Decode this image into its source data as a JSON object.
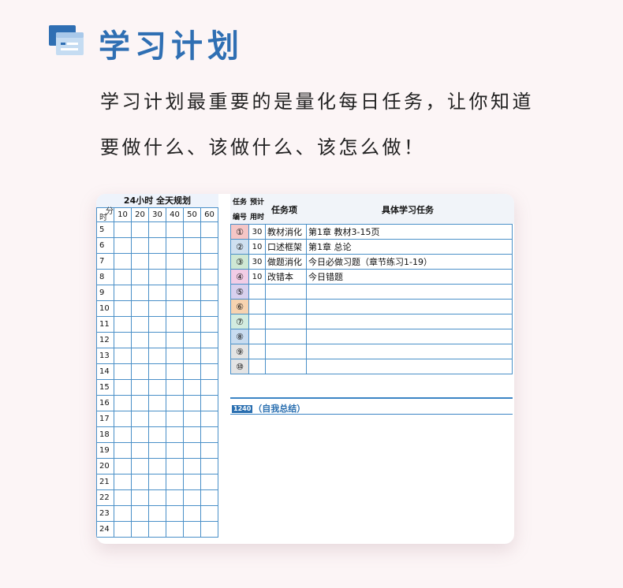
{
  "header": {
    "title": "学习计划",
    "intro_line1": "学习计划最重要的是量化每日任务，让你知道",
    "intro_line2": "要做什么、该做什么、该怎么做！"
  },
  "schedule": {
    "title": "24小时 全天规划",
    "corner_top": "分",
    "corner_bottom": "时",
    "minutes": [
      "10",
      "20",
      "30",
      "40",
      "50",
      "60"
    ],
    "hours": [
      "5",
      "6",
      "7",
      "8",
      "9",
      "10",
      "11",
      "12",
      "13",
      "14",
      "15",
      "16",
      "17",
      "18",
      "19",
      "20",
      "21",
      "22",
      "23",
      "24"
    ]
  },
  "tasks": {
    "col_num_top": "任务",
    "col_num_bottom": "编号",
    "col_time_top": "预计",
    "col_time_bottom": "用时",
    "col_name": "任务项",
    "col_detail": "具体学习任务",
    "rows": [
      {
        "num": "①",
        "color": "#f5c6c6",
        "minutes": "30",
        "name": "教材消化",
        "detail": "第1章 教材3-15页"
      },
      {
        "num": "②",
        "color": "#cfe0f0",
        "minutes": "10",
        "name": "口述框架",
        "detail": "第1章 总论"
      },
      {
        "num": "③",
        "color": "#cfe8d4",
        "minutes": "30",
        "name": "做题消化",
        "detail": "今日必做习题（章节练习1-19）"
      },
      {
        "num": "④",
        "color": "#f2cde6",
        "minutes": "10",
        "name": "改错本",
        "detail": "今日错题"
      },
      {
        "num": "⑤",
        "color": "#d8d0ee",
        "minutes": "",
        "name": "",
        "detail": ""
      },
      {
        "num": "⑥",
        "color": "#f7d3b0",
        "minutes": "",
        "name": "",
        "detail": ""
      },
      {
        "num": "⑦",
        "color": "#d3ece0",
        "minutes": "",
        "name": "",
        "detail": ""
      },
      {
        "num": "⑧",
        "color": "#c8dcf0",
        "minutes": "",
        "name": "",
        "detail": ""
      },
      {
        "num": "⑨",
        "color": "#e4e4e4",
        "minutes": "",
        "name": "",
        "detail": ""
      },
      {
        "num": "⑩",
        "color": "#e4e4e4",
        "minutes": "",
        "name": "",
        "detail": ""
      }
    ],
    "summary_tag": "1240",
    "summary_label": "（自我总结）"
  }
}
